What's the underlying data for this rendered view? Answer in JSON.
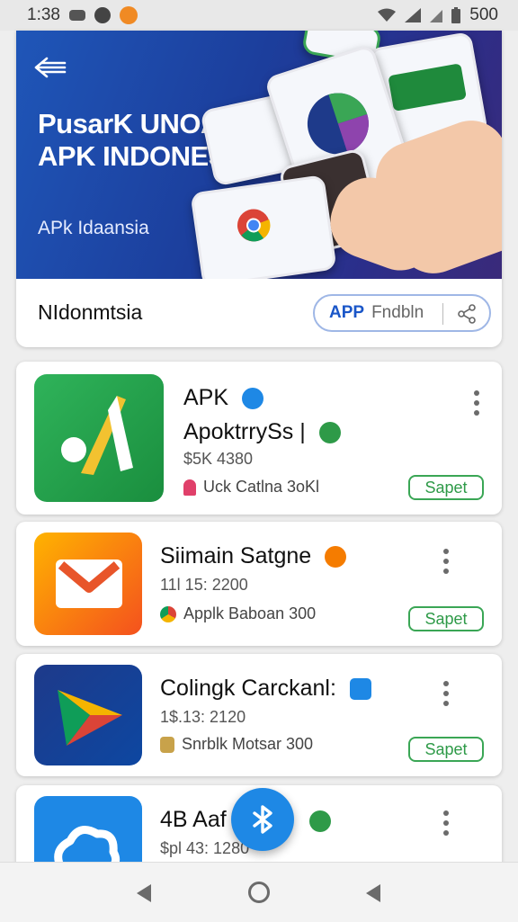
{
  "status_bar": {
    "time": "1:38",
    "battery": "500"
  },
  "hero": {
    "title": "PusarK UNOANI APK INDONESIA",
    "subtitle": "APk Idaansia",
    "section_title": "NIdonmtsia",
    "pill_tag": "APP",
    "pill_text": "Fndbln"
  },
  "apps": [
    {
      "name": "APK",
      "subtitle": "ApoktrrySs |",
      "meta": "$5K 4380",
      "note": "Uck Catlna 3oKl",
      "button": "Sapet",
      "icon": "green-arrow-app-icon"
    },
    {
      "name": "Siimain Satgne",
      "meta": "11l 15: 2200",
      "note": "Applk Baboan 300",
      "button": "Sapet",
      "icon": "mail-app-icon"
    },
    {
      "name": "Colingk Carckanl:",
      "meta": "1$.13: 2120",
      "note": "Snrblk Motsar 300",
      "button": "Sapet",
      "icon": "play-store-icon"
    },
    {
      "name": "4B Aaf",
      "meta": "$pl 43: 1280",
      "icon": "cloud-app-icon"
    }
  ],
  "colors": {
    "accent": "#1e88e5",
    "install_green": "#3aa655",
    "banner_blue": "#1f56b8"
  }
}
